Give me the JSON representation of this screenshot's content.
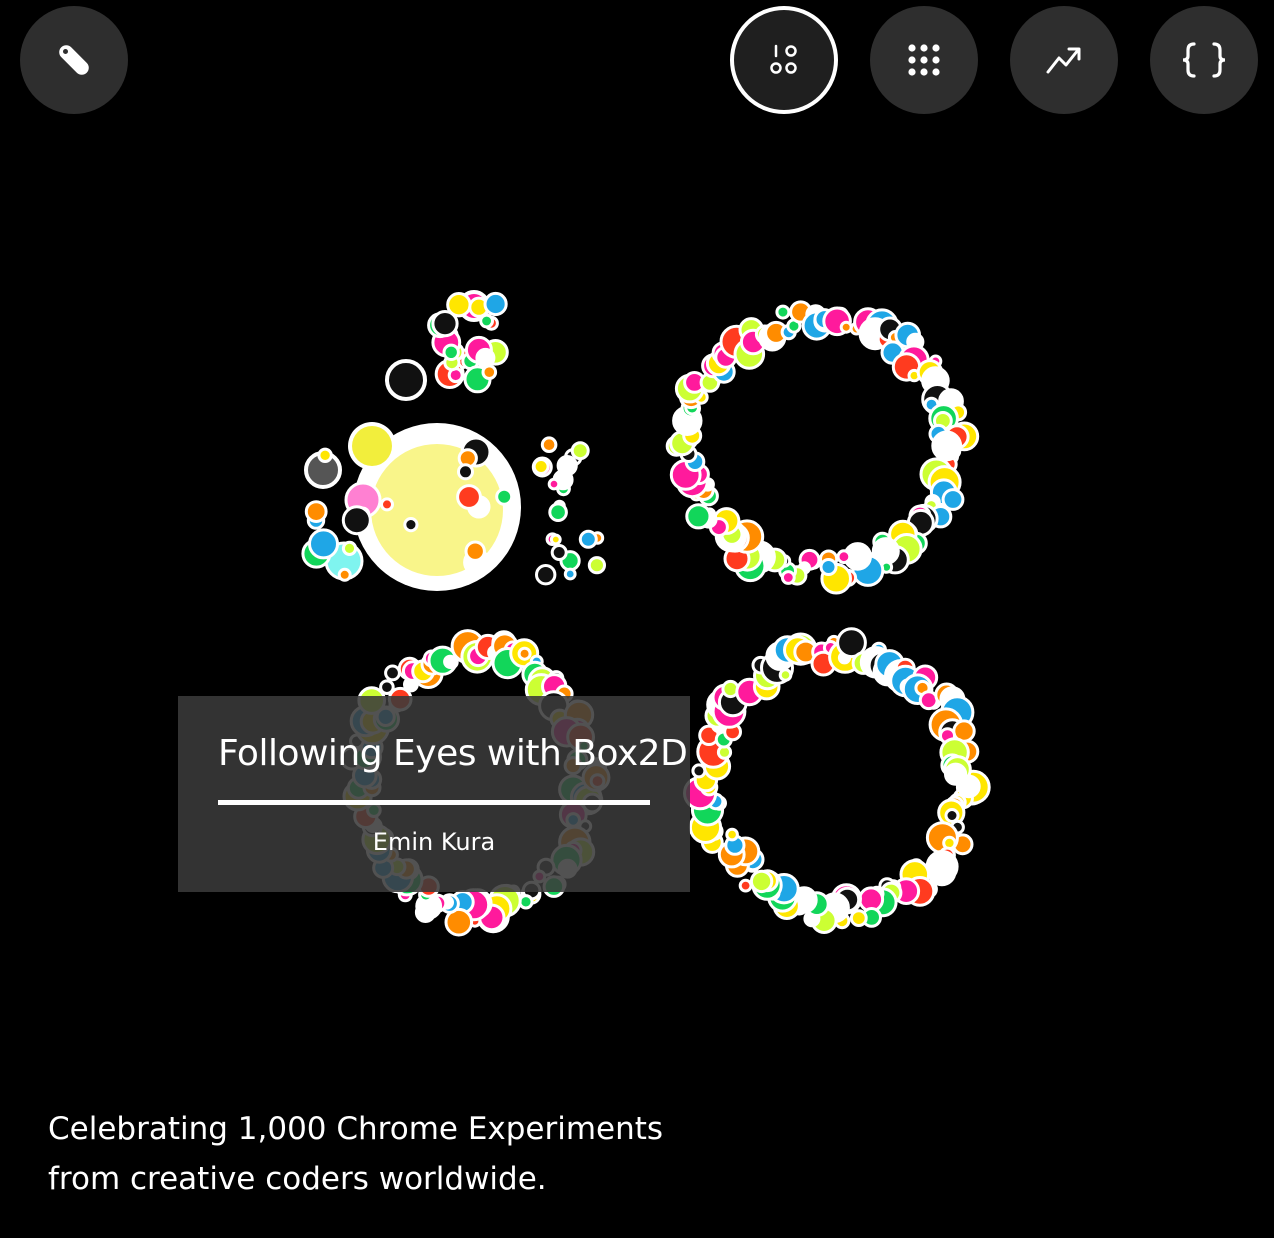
{
  "header": {
    "buttons": [
      {
        "name": "tag-button",
        "icon": "tag-icon"
      },
      {
        "name": "thousand-view-button",
        "icon": "one-thousand-icon",
        "active": true
      },
      {
        "name": "grid-view-button",
        "icon": "grid-icon"
      },
      {
        "name": "trending-button",
        "icon": "trend-icon"
      },
      {
        "name": "code-button",
        "icon": "code-braces-icon"
      }
    ],
    "thousand_icon_glyphs": "1 0 0 0"
  },
  "caption": {
    "title": "Following Eyes with Box2D",
    "author": "Emin Kura"
  },
  "tagline": {
    "line1": "Celebrating 1,000 Chrome Experiments",
    "line2": "from creative coders worldwide."
  },
  "colors": {
    "background": "#000000",
    "button_bg": "#2e2e2e",
    "ball_palette": [
      "#ff1a9c",
      "#ffe600",
      "#1fa6e6",
      "#12d65a",
      "#ff8c00",
      "#111111",
      "#ffffff",
      "#ff3b1f",
      "#ccff33"
    ]
  }
}
